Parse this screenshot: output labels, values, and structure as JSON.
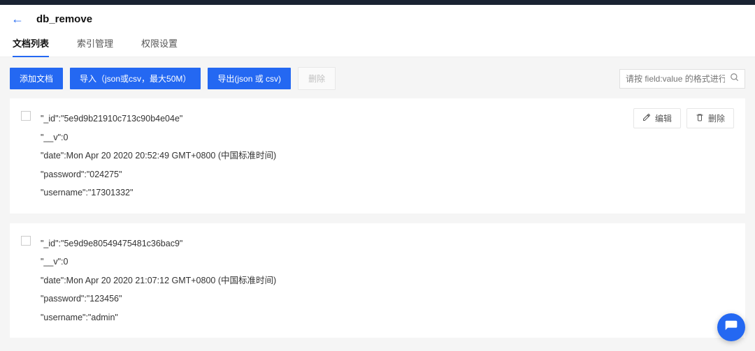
{
  "header": {
    "title": "db_remove"
  },
  "tabs": [
    {
      "label": "文档列表",
      "active": true
    },
    {
      "label": "索引管理",
      "active": false
    },
    {
      "label": "权限设置",
      "active": false
    }
  ],
  "toolbar": {
    "add_label": "添加文档",
    "import_label": "导入（json或csv，最大50M）",
    "export_label": "导出(json 或 csv)",
    "delete_label": "删除"
  },
  "search": {
    "placeholder": "请按 field:value 的格式进行搜索"
  },
  "card_actions": {
    "edit_label": "编辑",
    "delete_label": "删除"
  },
  "docs": [
    {
      "lines": [
        "\"_id\":\"5e9d9b21910c713c90b4e04e\"",
        "\"__v\":0",
        "\"date\":Mon Apr 20 2020 20:52:49 GMT+0800 (中国标准时间)",
        "\"password\":\"024275\"",
        "\"username\":\"17301332\""
      ]
    },
    {
      "lines": [
        "\"_id\":\"5e9d9e80549475481c36bac9\"",
        "\"__v\":0",
        "\"date\":Mon Apr 20 2020 21:07:12 GMT+0800 (中国标准时间)",
        "\"password\":\"123456\"",
        "\"username\":\"admin\""
      ]
    }
  ]
}
